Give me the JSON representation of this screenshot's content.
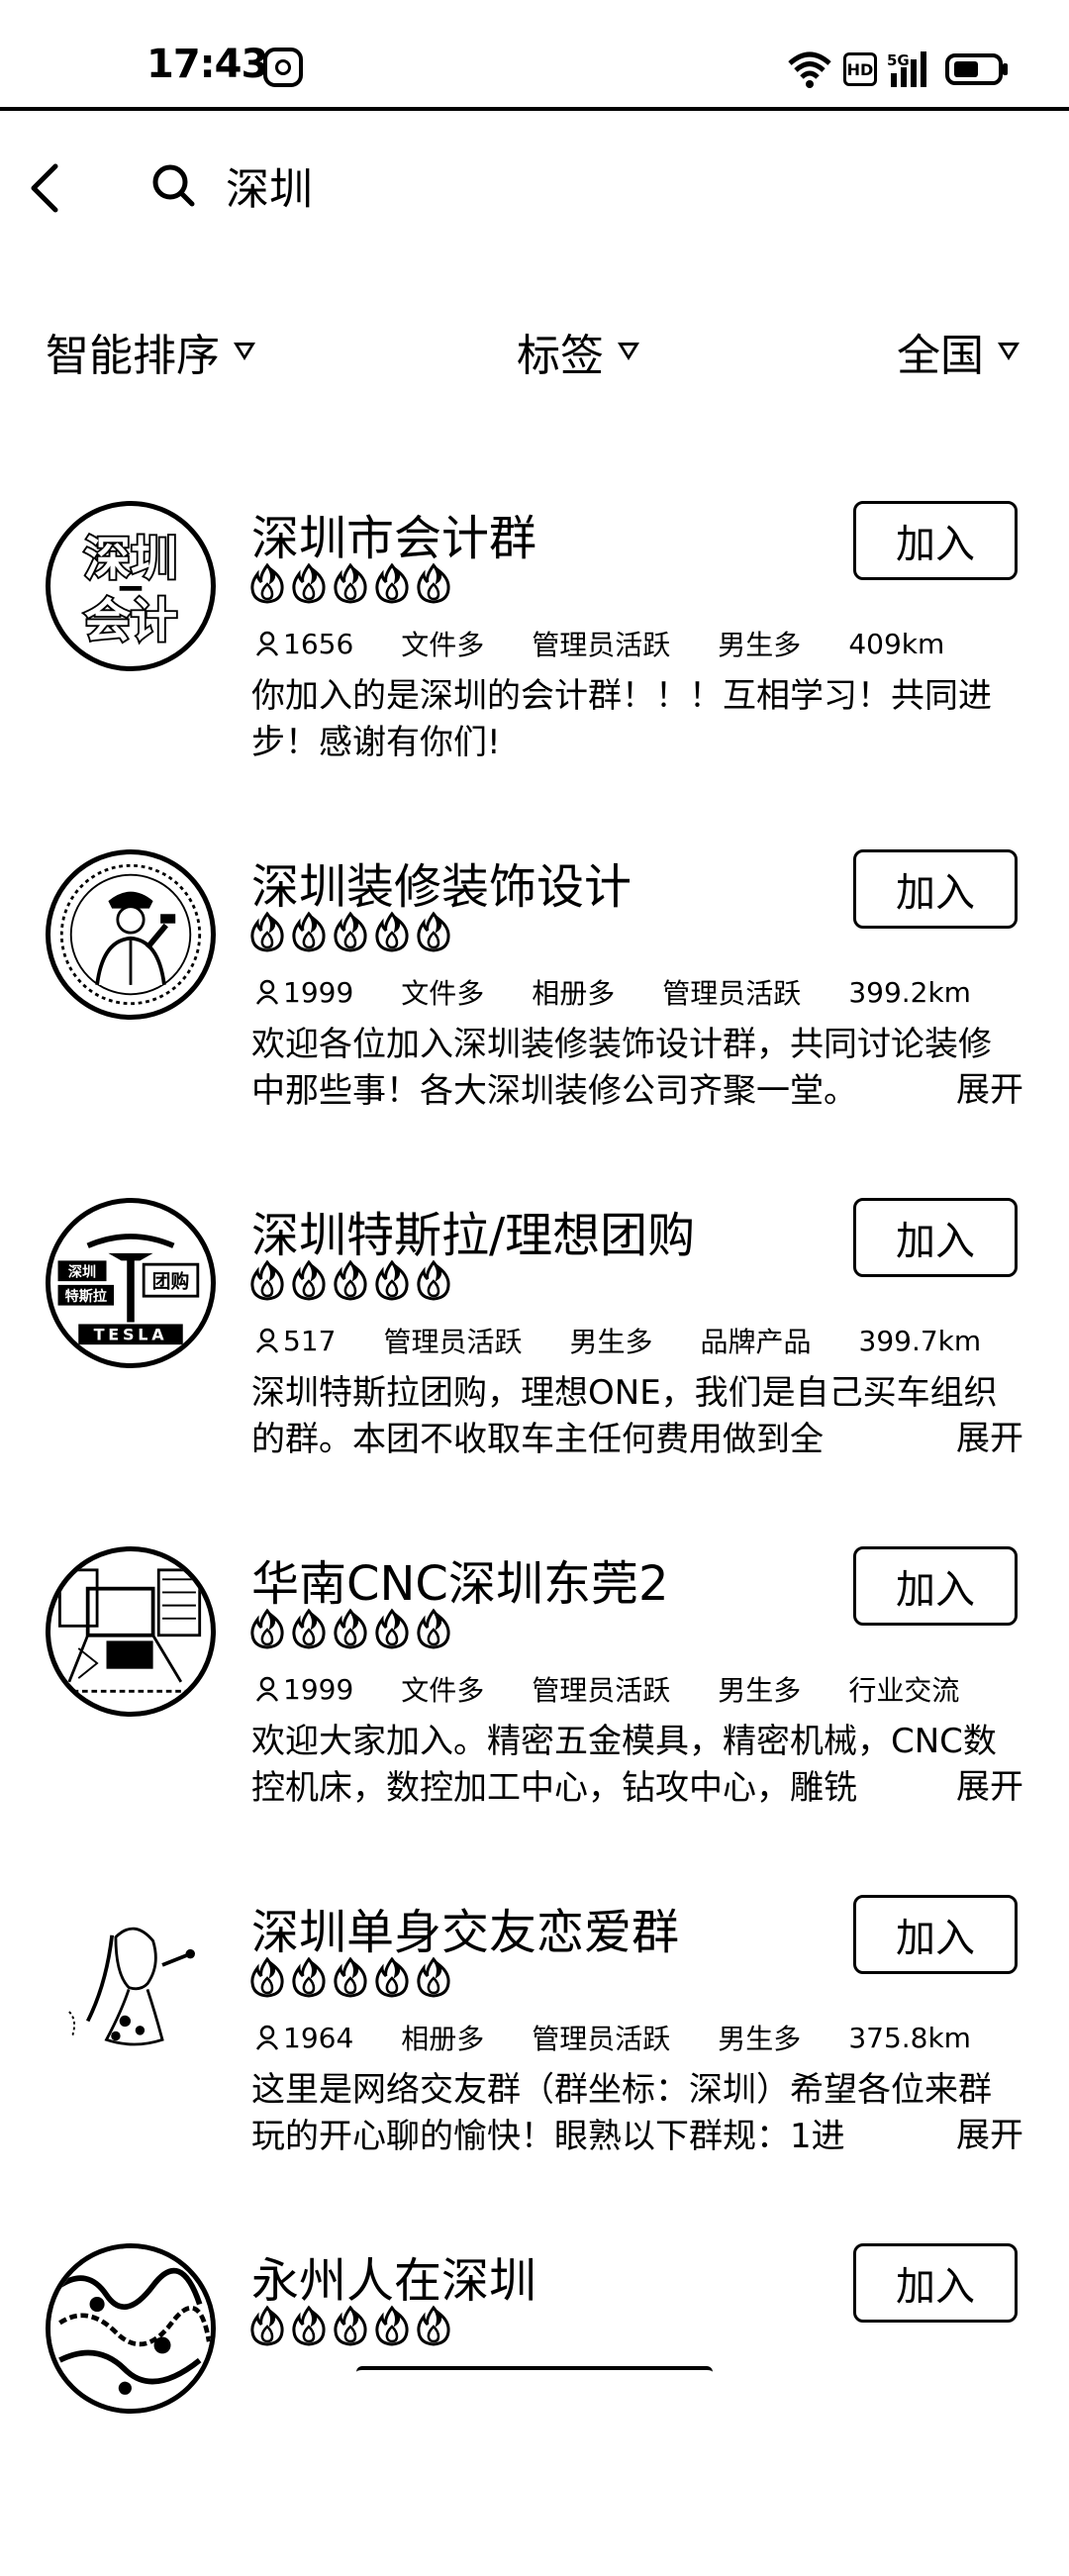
{
  "status_bar": {
    "time": "17:43",
    "icons": [
      "camera-app-icon",
      "wifi-icon",
      "hd-badge",
      "5g-signal-icon",
      "battery-icon"
    ],
    "hd_label": "HD"
  },
  "search": {
    "query": "深圳"
  },
  "filters": [
    {
      "label": "智能排序"
    },
    {
      "label": "标签"
    },
    {
      "label": "全国"
    }
  ],
  "join_label": "加入",
  "expand_label": "展开",
  "groups": [
    {
      "name": "深圳市会计群",
      "avatar_text": [
        "深圳",
        "会计"
      ],
      "flames": 5,
      "members": "1656",
      "tags": [
        "文件多",
        "管理员活跃",
        "男生多",
        "409km"
      ],
      "description": "你加入的是深圳的会计群！！！互相学习！共同进步！感谢有你们!",
      "has_expand": false
    },
    {
      "name": "深圳装修装饰设计",
      "avatar_text": [],
      "flames": 5,
      "members": "1999",
      "tags": [
        "文件多",
        "相册多",
        "管理员活跃",
        "399.2km"
      ],
      "description": "欢迎各位加入深圳装修装饰设计群，共同讨论装修中那些事！各大深圳装修公司齐聚一堂。",
      "has_expand": true
    },
    {
      "name": "深圳特斯拉/理想团购",
      "avatar_text": [
        "深圳",
        "特斯拉",
        "团购",
        "TESLA"
      ],
      "flames": 5,
      "members": "517",
      "tags": [
        "管理员活跃",
        "男生多",
        "品牌产品",
        "399.7km"
      ],
      "description": "深圳特斯拉团购，理想ONE，我们是自己买车组织的群。本团不收取车主任何费用做到全",
      "has_expand": true
    },
    {
      "name": "华南CNC深圳东莞2",
      "avatar_text": [],
      "flames": 5,
      "members": "1999",
      "tags": [
        "文件多",
        "管理员活跃",
        "男生多",
        "行业交流"
      ],
      "description": "欢迎大家加入。精密五金模具，精密机械，CNC数控机床，数控加工中心，钻攻中心，雕铣",
      "has_expand": true
    },
    {
      "name": "深圳单身交友恋爱群",
      "avatar_text": [],
      "flames": 5,
      "members": "1964",
      "tags": [
        "相册多",
        "管理员活跃",
        "男生多",
        "375.8km"
      ],
      "description": "这里是网络交友群（群坐标：深圳）希望各位来群玩的开心聊的愉快！眼熟以下群规：1进",
      "has_expand": true
    },
    {
      "name": "永州人在深圳",
      "avatar_text": [],
      "flames": 5,
      "members": "",
      "tags": [],
      "description": "",
      "has_expand": false
    }
  ]
}
